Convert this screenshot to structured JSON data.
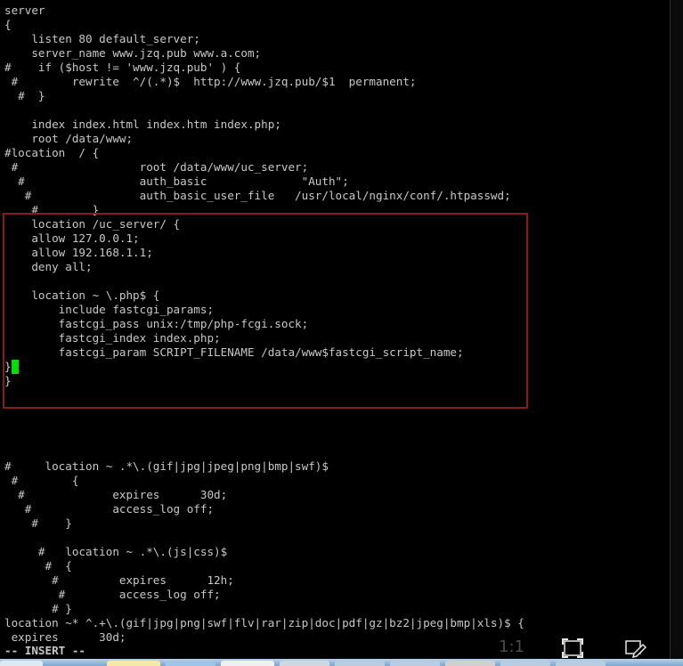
{
  "editor": {
    "lines": [
      "server",
      "{",
      "    listen 80 default_server;",
      "    server_name www.jzq.pub www.a.com;",
      "#    if ($host != 'www.jzq.pub' ) {",
      " #        rewrite  ^/(.*)$  http://www.jzq.pub/$1  permanent;",
      "  #  }",
      "",
      "    index index.html index.htm index.php;",
      "    root /data/www;",
      "#location  / {",
      " #                  root /data/www/uc_server;",
      "  #                 auth_basic              \"Auth\";",
      "   #                auth_basic_user_file   /usr/local/nginx/conf/.htpasswd;",
      "    #        }",
      "    location /uc_server/ {",
      "    allow 127.0.0.1;",
      "    allow 192.168.1.1;",
      "    deny all;",
      "",
      "    location ~ \\.php$ {",
      "        include fastcgi_params;",
      "        fastcgi_pass unix:/tmp/php-fcgi.sock;",
      "        fastcgi_index index.php;",
      "        fastcgi_param SCRIPT_FILENAME /data/www$fastcgi_script_name;",
      "}",
      "}",
      "",
      "",
      "",
      "",
      "",
      "#     location ~ .*\\.(gif|jpg|jpeg|png|bmp|swf)$",
      " #        {",
      "  #             expires      30d;",
      "   #            access_log off;",
      "    #    }",
      "",
      "     #   location ~ .*\\.(js|css)$",
      "      #  {",
      "       #         expires      12h;",
      "        #        access_log off;",
      "       # }",
      "location ~* ^.+\\.(gif|jpg|png|swf|flv|rar|zip|doc|pdf|gz|bz2|jpeg|bmp|xls)$ {",
      " expires      30d;"
    ],
    "mode_line": "-- INSERT --",
    "cursor_color": "#00e000",
    "text_color": "#c8c8c8",
    "background_color": "#000000",
    "highlight_color": "#8b1a1a"
  },
  "viewer_controls": {
    "zoom_label": "1:1",
    "fullscreen_icon": "fullscreen-icon",
    "edit_icon": "edit-screenshot-icon"
  }
}
